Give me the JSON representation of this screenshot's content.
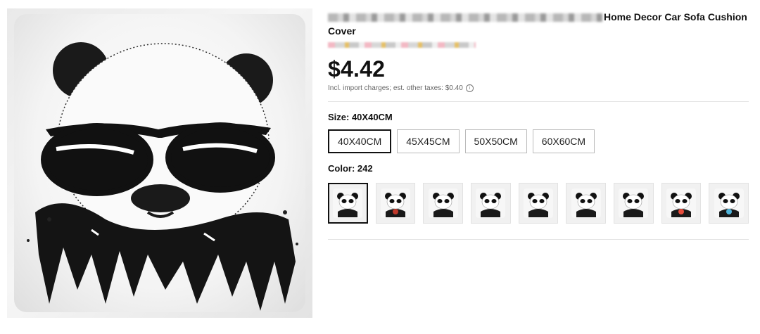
{
  "product": {
    "title_tail": "Home Decor Car Sofa Cushion Cover",
    "title_line2": "Cover",
    "price": "$4.42",
    "tax_note": "Incl. import charges; est. other taxes: $0.40",
    "info_icon": "info-icon"
  },
  "size_option": {
    "label": "Size: 40X40CM",
    "options": [
      "40X40CM",
      "45X45CM",
      "50X50CM",
      "60X60CM"
    ],
    "selected": "40X40CM"
  },
  "color_option": {
    "label": "Color: 242",
    "selected_index": 0,
    "swatch_count": 9
  }
}
